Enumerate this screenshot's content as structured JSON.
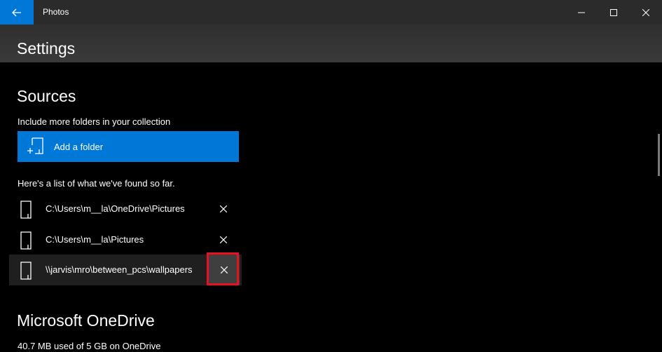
{
  "titlebar": {
    "app_title": "Photos",
    "back_icon": "back-arrow-icon",
    "controls": [
      "minimize-icon",
      "maximize-icon",
      "close-icon"
    ]
  },
  "header": {
    "title": "Settings"
  },
  "sources": {
    "title": "Sources",
    "subtitle": "Include more folders in your collection",
    "add_button_label": "Add a folder",
    "list_intro": "Here's a list of what we've found so far.",
    "folders": [
      {
        "path": "C:\\Users\\m__la\\OneDrive\\Pictures"
      },
      {
        "path": "C:\\Users\\m__la\\Pictures"
      },
      {
        "path": "\\\\jarvis\\mro\\between_pcs\\wallpapers"
      }
    ]
  },
  "onedrive": {
    "title": "Microsoft OneDrive",
    "usage": "40.7 MB used of 5 GB on OneDrive"
  },
  "colors": {
    "accent": "#0078d7",
    "highlight": "#e81123"
  }
}
